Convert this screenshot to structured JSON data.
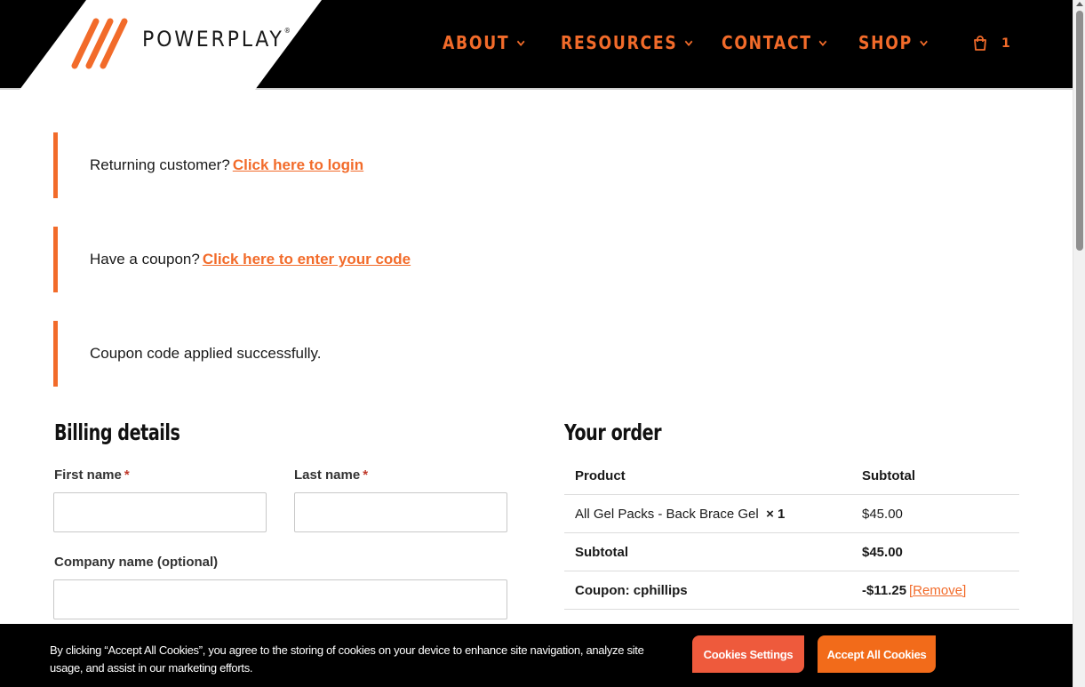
{
  "brand": {
    "name": "POWERPLAY",
    "reg": "®",
    "accent": "#f26b2a"
  },
  "nav": [
    {
      "label": "ABOUT"
    },
    {
      "label": "RESOURCES"
    },
    {
      "label": "CONTACT"
    },
    {
      "label": "SHOP"
    }
  ],
  "cart": {
    "icon": "cart-icon",
    "count": "1"
  },
  "notices": {
    "login": {
      "text": "Returning customer?",
      "link": "Click here to login"
    },
    "coupon": {
      "text": "Have a coupon?",
      "link": "Click here to enter your code"
    },
    "applied": {
      "text": "Coupon code applied successfully."
    }
  },
  "billing": {
    "title": "Billing details",
    "first_name": {
      "label": "First name",
      "required": "*",
      "value": ""
    },
    "last_name": {
      "label": "Last name",
      "required": "*",
      "value": ""
    },
    "company": {
      "label": "Company name (optional)",
      "value": ""
    }
  },
  "order": {
    "title": "Your order",
    "header": {
      "product": "Product",
      "subtotal": "Subtotal"
    },
    "item": {
      "name": "All Gel Packs - Back Brace Gel",
      "qty": "× 1",
      "price": "$45.00"
    },
    "subtotal": {
      "label": "Subtotal",
      "value": "$45.00"
    },
    "coupon": {
      "label": "Coupon: cphillips",
      "value": "-$11.25",
      "remove": "[Remove]"
    }
  },
  "cookie_banner": {
    "text": "By clicking “Accept All Cookies”, you agree to the storing of cookies on your device to enhance site navigation, analyze site usage, and assist in our marketing efforts.",
    "settings_label": "Cookies Settings",
    "accept_label": "Accept All Cookies"
  }
}
